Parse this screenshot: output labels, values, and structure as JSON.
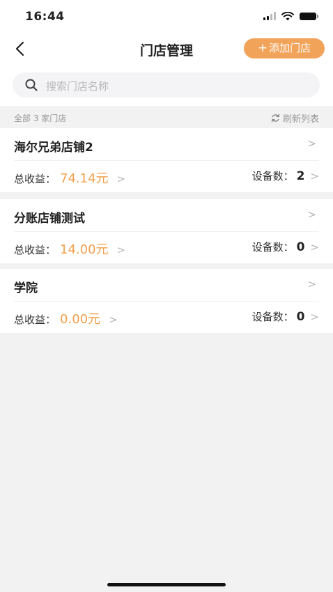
{
  "status_bar": {
    "time": "16:44",
    "icons": [
      "signal-icon",
      "wifi-icon",
      "battery-icon"
    ]
  },
  "nav": {
    "title": "门店管理",
    "add_button_plus": "+",
    "add_button_label": "添加门店",
    "back_icon": "chevron-left-icon"
  },
  "search": {
    "placeholder": "搜索门店名称",
    "icon": "search-icon"
  },
  "list_header": {
    "count_text": "全部 3 家门店",
    "refresh_label": "刷新列表",
    "refresh_icon": "refresh-icon"
  },
  "stores": [
    {
      "name": "海尔兄弟店铺2",
      "revenue_label": "总收益：",
      "revenue": "74.14元",
      "devices_label": "设备数：",
      "devices": "2"
    },
    {
      "name": "分账店铺测试",
      "revenue_label": "总收益：",
      "revenue": "14.00元",
      "devices_label": "设备数：",
      "devices": "0"
    },
    {
      "name": "学院",
      "revenue_label": "总收益：",
      "revenue": "0.00元",
      "devices_label": "设备数：",
      "devices": "0"
    }
  ],
  "chevron_glyph": ">",
  "colors": {
    "accent": "#f2a35a",
    "revenue": "#f0a04b",
    "background": "#f2f2f2"
  }
}
